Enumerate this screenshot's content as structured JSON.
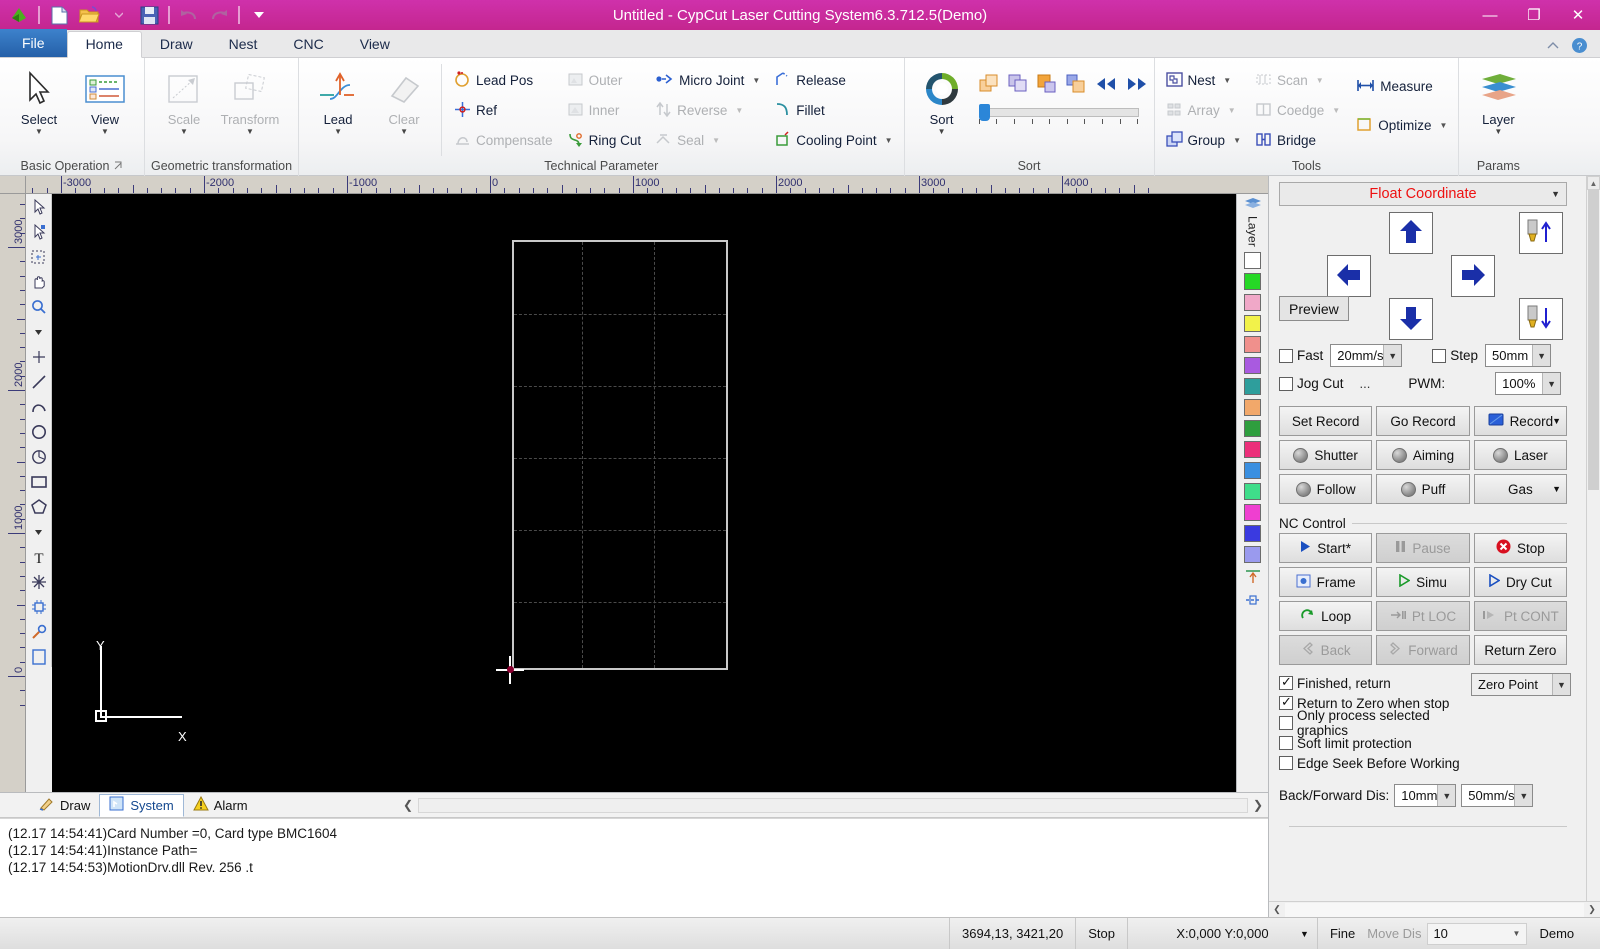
{
  "window": {
    "title": "Untitled - CypCut Laser Cutting System6.3.712.5(Demo)",
    "minimize": "—",
    "maximize": "❐",
    "close": "✕"
  },
  "quick_access": [
    "logo-icon",
    "new-icon",
    "open-icon",
    "save-icon",
    "undo-icon",
    "redo-icon",
    "customize-icon"
  ],
  "tabs": [
    {
      "label": "File",
      "active": false,
      "file": true
    },
    {
      "label": "Home",
      "active": true
    },
    {
      "label": "Draw",
      "active": false
    },
    {
      "label": "Nest",
      "active": false
    },
    {
      "label": "CNC",
      "active": false
    },
    {
      "label": "View",
      "active": false
    }
  ],
  "ribbon": {
    "groups": [
      {
        "title": "Basic Operation",
        "has_launcher": true,
        "big": [
          {
            "label": "Select",
            "icon": "cursor-icon",
            "caret": true,
            "disabled": false
          },
          {
            "label": "View",
            "icon": "view-list-icon",
            "caret": true,
            "disabled": false
          }
        ]
      },
      {
        "title": "Geometric transformation",
        "has_launcher": false,
        "big": [
          {
            "label": "Scale",
            "icon": "scale-icon",
            "caret": true,
            "disabled": true
          },
          {
            "label": "Transform",
            "icon": "transform-icon",
            "caret": true,
            "disabled": true
          }
        ]
      },
      {
        "title": "Technical Parameter",
        "has_launcher": false,
        "big": [
          {
            "label": "Lead",
            "icon": "lead-icon",
            "caret": true,
            "disabled": false
          },
          {
            "label": "Clear",
            "icon": "eraser-icon",
            "caret": true,
            "disabled": true
          }
        ],
        "columns": [
          [
            {
              "label": "Lead Pos",
              "icon": "lead-pos-icon",
              "disabled": false,
              "caret": false
            },
            {
              "label": "Ref",
              "icon": "ref-icon",
              "disabled": false,
              "caret": false
            },
            {
              "label": "Compensate",
              "icon": "compensate-icon",
              "disabled": true,
              "caret": false
            }
          ],
          [
            {
              "label": "Outer",
              "icon": "outer-icon",
              "disabled": true,
              "caret": false
            },
            {
              "label": "Inner",
              "icon": "inner-icon",
              "disabled": true,
              "caret": false
            },
            {
              "label": "Ring Cut",
              "icon": "ring-cut-icon",
              "disabled": false,
              "caret": false
            }
          ],
          [
            {
              "label": "Micro Joint",
              "icon": "micro-joint-icon",
              "disabled": false,
              "caret": true
            },
            {
              "label": "Reverse",
              "icon": "reverse-icon",
              "disabled": true,
              "caret": true
            },
            {
              "label": "Seal",
              "icon": "seal-icon",
              "disabled": true,
              "caret": true
            }
          ],
          [
            {
              "label": "Release",
              "icon": "release-icon",
              "disabled": false,
              "caret": false
            },
            {
              "label": "Fillet",
              "icon": "fillet-icon",
              "disabled": false,
              "caret": false
            },
            {
              "label": "Cooling Point",
              "icon": "cooling-point-icon",
              "disabled": false,
              "caret": true
            }
          ]
        ]
      },
      {
        "title": "Sort",
        "has_launcher": false,
        "big": [
          {
            "label": "Sort",
            "icon": "sort-circle-icon",
            "caret": true,
            "disabled": false
          }
        ],
        "sort_icons": [
          "sort-fwd-icon",
          "sort-back-icon",
          "sort-up-icon",
          "sort-down-icon",
          "rewind-icon",
          "fastforward-icon"
        ],
        "slider_value": 0
      },
      {
        "title": "Tools",
        "has_launcher": false,
        "columns": [
          [
            {
              "label": "Nest",
              "icon": "nest-icon",
              "disabled": false,
              "caret": true
            },
            {
              "label": "Array",
              "icon": "array-icon",
              "disabled": true,
              "caret": true
            },
            {
              "label": "Group",
              "icon": "group-icon",
              "disabled": false,
              "caret": true
            }
          ],
          [
            {
              "label": "Scan",
              "icon": "scan-icon",
              "disabled": true,
              "caret": true
            },
            {
              "label": "Coedge",
              "icon": "coedge-icon",
              "disabled": true,
              "caret": true
            },
            {
              "label": "Bridge",
              "icon": "bridge-icon",
              "disabled": false,
              "caret": false
            }
          ],
          [
            {
              "label": "Measure",
              "icon": "measure-icon",
              "disabled": false,
              "caret": false
            },
            {
              "label": "Optimize",
              "icon": "optimize-icon",
              "disabled": false,
              "caret": true
            }
          ]
        ]
      },
      {
        "title": "Params",
        "has_launcher": false,
        "big": [
          {
            "label": "Layer",
            "icon": "layer-icon",
            "caret": true,
            "disabled": false
          }
        ]
      }
    ]
  },
  "canvas": {
    "h_ruler_labels": [
      "-3000",
      "-2000",
      "-1000",
      "0",
      "1000",
      "2000",
      "3000",
      "4000"
    ],
    "v_ruler_labels": [
      "3000",
      "2000",
      "1000",
      "0"
    ],
    "axis_x_label": "X",
    "axis_y_label": "Y"
  },
  "layer_palette": {
    "tab_label": "Layer",
    "colors": [
      "#ffffff",
      "#26d826",
      "#f0a8c8",
      "#f2f24a",
      "#f0908c",
      "#a95ae0",
      "#2e9e9c",
      "#f2a86a",
      "#2f9e3e",
      "#ec2f7a",
      "#3a8fe0",
      "#3fdd8a",
      "#ef3fd0",
      "#3a3ae0",
      "#9a9aee"
    ]
  },
  "bottom_panel": {
    "tabs": [
      {
        "label": "Draw",
        "icon": "draw-icon",
        "active": false
      },
      {
        "label": "System",
        "icon": "system-icon",
        "active": true
      },
      {
        "label": "Alarm",
        "icon": "alarm-icon",
        "active": false
      }
    ],
    "log_lines": [
      "(12.17 14:54:41)Card Number =0, Card type BMC1604",
      "(12.17 14:54:41)Instance Path=",
      "(12.17 14:54:53)MotionDrv.dll Rev. 256 .t"
    ]
  },
  "right_panel": {
    "coordinate_mode": "Float Coordinate",
    "jog": {
      "up": "jog-up-icon",
      "down": "jog-down-icon",
      "left": "jog-left-icon",
      "right": "jog-right-icon",
      "nozzle_up": "nozzle-up-icon",
      "nozzle_down": "nozzle-down-icon",
      "preview_label": "Preview"
    },
    "options": {
      "fast_label": "Fast",
      "fast_checked": false,
      "fast_speed": "20mm/s",
      "step_label": "Step",
      "step_checked": false,
      "step_value": "50mm",
      "jog_cut_label": "Jog Cut",
      "jog_cut_checked": false,
      "jog_cut_more": "...",
      "pwm_label": "PWM:",
      "pwm_value": "100%"
    },
    "control_buttons": [
      {
        "label": "Set Record",
        "disabled": false,
        "icon": null,
        "dropdown": false
      },
      {
        "label": "Go Record",
        "disabled": false,
        "icon": null,
        "dropdown": false
      },
      {
        "label": "Record",
        "disabled": false,
        "icon": "record-blue-icon",
        "dropdown": true
      },
      {
        "label": "Shutter",
        "disabled": false,
        "icon": "led-icon",
        "dropdown": false
      },
      {
        "label": "Aiming",
        "disabled": false,
        "icon": "led-icon",
        "dropdown": false
      },
      {
        "label": "Laser",
        "disabled": false,
        "icon": "led-icon",
        "dropdown": false
      },
      {
        "label": "Follow",
        "disabled": false,
        "icon": "led-icon",
        "dropdown": false
      },
      {
        "label": "Puff",
        "disabled": false,
        "icon": "led-icon",
        "dropdown": false
      },
      {
        "label": "Gas",
        "disabled": false,
        "icon": null,
        "dropdown": true
      }
    ],
    "nc_control": {
      "legend": "NC Control",
      "buttons": [
        {
          "label": "Start*",
          "icon": "play-blue-icon",
          "disabled": false
        },
        {
          "label": "Pause",
          "icon": "pause-icon",
          "disabled": true
        },
        {
          "label": "Stop",
          "icon": "stop-red-icon",
          "disabled": false
        },
        {
          "label": "Frame",
          "icon": "frame-icon",
          "disabled": false
        },
        {
          "label": "Simu",
          "icon": "play-green-icon",
          "disabled": false
        },
        {
          "label": "Dry Cut",
          "icon": "play-outline-icon",
          "disabled": false
        },
        {
          "label": "Loop",
          "icon": "loop-green-icon",
          "disabled": false
        },
        {
          "label": "Pt LOC",
          "icon": "pt-loc-icon",
          "disabled": true
        },
        {
          "label": "Pt CONT",
          "icon": "pt-cont-icon",
          "disabled": true
        },
        {
          "label": "Back",
          "icon": "back-icon",
          "disabled": true
        },
        {
          "label": "Forward",
          "icon": "forward-icon",
          "disabled": true
        },
        {
          "label": "Return Zero",
          "icon": null,
          "disabled": false
        }
      ]
    },
    "checkboxes": [
      {
        "label": "Finished, return",
        "checked": true
      },
      {
        "label": "Return to Zero when stop",
        "checked": true
      },
      {
        "label": "Only process selected graphics",
        "checked": false
      },
      {
        "label": "Soft limit protection",
        "checked": false
      },
      {
        "label": "Edge Seek Before Working",
        "checked": false
      }
    ],
    "zero_point_value": "Zero Point",
    "back_forward": {
      "label": "Back/Forward Dis:",
      "distance": "10mm",
      "speed": "50mm/s"
    }
  },
  "status_bar": {
    "coords": "3694,13, 3421,20",
    "state": "Stop",
    "offset": "X:0,000 Y:0,000",
    "fine": "Fine",
    "move_dis_label": "Move Dis",
    "move_dis_value": "10",
    "mode": "Demo"
  }
}
